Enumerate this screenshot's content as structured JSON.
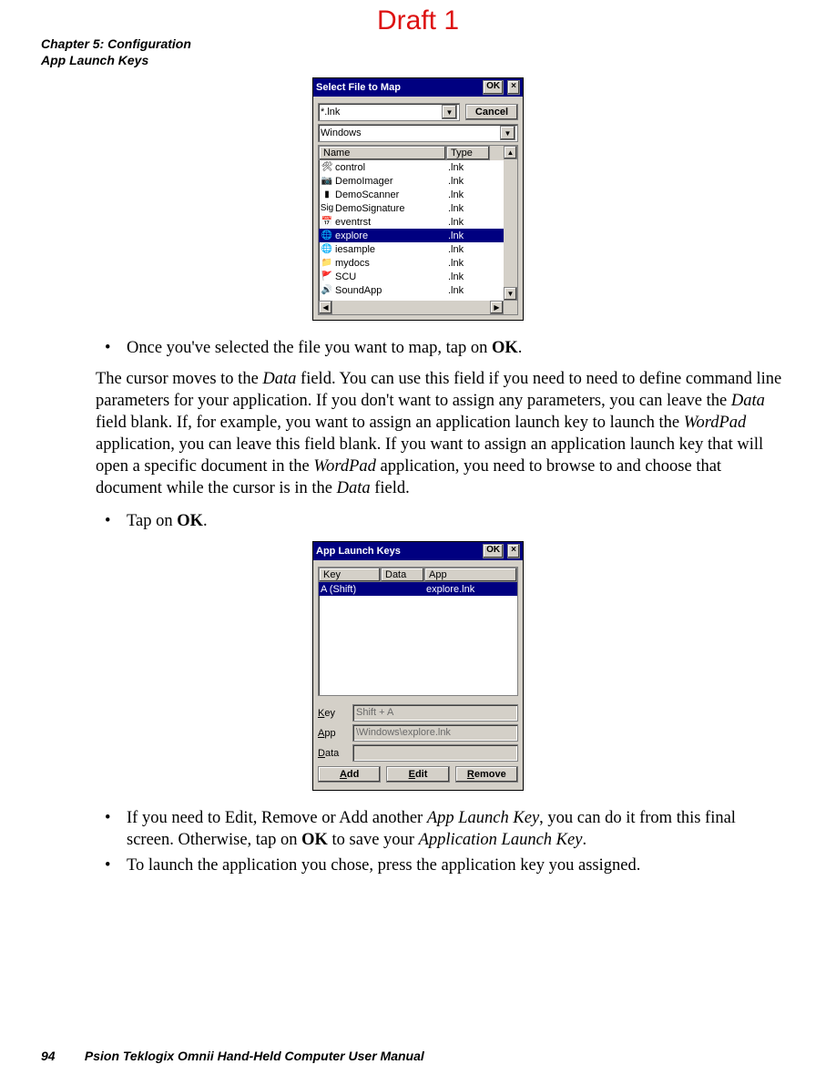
{
  "watermark": "Draft 1",
  "header": {
    "chapter": "Chapter 5:  Configuration",
    "section": "App Launch Keys"
  },
  "dialog1": {
    "title": "Select File to Map",
    "ok": "OK",
    "close": "×",
    "cancel": "Cancel",
    "filter_value": "*.lnk",
    "folder_value": "Windows",
    "columns": {
      "name": "Name",
      "type": "Type"
    },
    "rows": [
      {
        "icon": "control-panel-icon",
        "name": "control",
        "type": ".lnk",
        "selected": false
      },
      {
        "icon": "camera-icon",
        "name": "DemoImager",
        "type": ".lnk",
        "selected": false
      },
      {
        "icon": "barcode-icon",
        "name": "DemoScanner",
        "type": ".lnk",
        "selected": false
      },
      {
        "icon": "signature-icon",
        "name": "DemoSignature",
        "type": ".lnk",
        "selected": false
      },
      {
        "icon": "calendar-icon",
        "name": "eventrst",
        "type": ".lnk",
        "selected": false
      },
      {
        "icon": "ie-icon",
        "name": "explore",
        "type": ".lnk",
        "selected": true
      },
      {
        "icon": "ie-icon",
        "name": "iesample",
        "type": ".lnk",
        "selected": false
      },
      {
        "icon": "folder-icon",
        "name": "mydocs",
        "type": ".lnk",
        "selected": false
      },
      {
        "icon": "flag-icon",
        "name": "SCU",
        "type": ".lnk",
        "selected": false
      },
      {
        "icon": "speaker-icon",
        "name": "SoundApp",
        "type": ".lnk",
        "selected": false
      }
    ]
  },
  "text": {
    "bullet1_pre": "Once you've selected the file you want to map, tap on ",
    "bullet1_bold": "OK",
    "bullet1_post": ".",
    "para1": "The cursor moves to the Data field. You can use this field if you need to need to define command line parameters for your application. If you don't want to assign any parameters, you can leave the Data field blank. If, for example, you want to assign an application launch key to launch the WordPad application, you can leave this field blank. If you want to assign an application launch key that will open a specific document in the WordPad application, you need to browse to and choose that document while the cursor is in the Data field.",
    "bullet2_pre": "Tap on ",
    "bullet2_bold": "OK",
    "bullet2_post": ".",
    "bullet3_a": "If you need to Edit, Remove or Add another ",
    "bullet3_i1": "App Launch Key",
    "bullet3_b": ", you can do it from this final screen. Otherwise, tap on ",
    "bullet3_bold": "OK",
    "bullet3_c": " to save your ",
    "bullet3_i2": "Application Launch Key",
    "bullet3_d": ".",
    "bullet4": "To launch the application you chose, press the application key you assigned."
  },
  "dialog2": {
    "title": "App Launch Keys",
    "ok": "OK",
    "close": "×",
    "columns": {
      "key": "Key",
      "data": "Data",
      "app": "App"
    },
    "rows": [
      {
        "key": "A (Shift)",
        "data": "",
        "app": "explore.lnk",
        "selected": true
      }
    ],
    "labels": {
      "key": "Key",
      "app": "App",
      "data": "Data"
    },
    "fields": {
      "key": "Shift + A",
      "app": "\\Windows\\explore.lnk",
      "data": ""
    },
    "buttons": {
      "add": "Add",
      "edit": "Edit",
      "remove": "Remove"
    }
  },
  "footer": {
    "page": "94",
    "title": "Psion Teklogix Omnii Hand-Held Computer User Manual"
  }
}
